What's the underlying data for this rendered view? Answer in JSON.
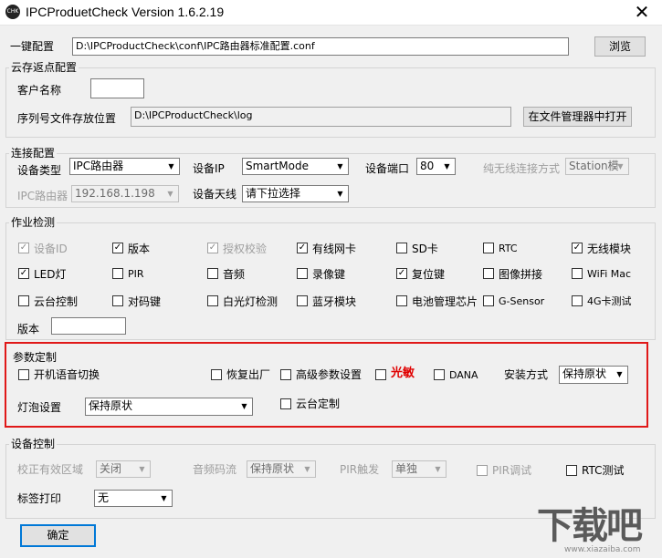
{
  "window": {
    "title": "IPCProduetCheck Version 1.6.2.19",
    "close": "✕",
    "icon_text": "CHK"
  },
  "top": {
    "label": "一键配置",
    "path": "D:\\IPCProductCheck\\conf\\IPC路由器标准配置.conf",
    "browse": "浏览"
  },
  "cloud": {
    "title": "云存返点配置",
    "customer_label": "客户名称",
    "customer_value": "",
    "serial_label": "序列号文件存放位置",
    "serial_path": "D:\\IPCProductCheck\\log",
    "open_btn": "在文件管理器中打开"
  },
  "conn": {
    "title": "连接配置",
    "device_type_label": "设备类型",
    "device_type": "IPC路由器",
    "device_ip_label": "设备IP",
    "device_ip": "SmartMode",
    "port_label": "设备端口",
    "port": "80",
    "wireless_label": "纯无线连接方式",
    "wireless_value": "Station模",
    "ipc_router_label": "IPC路由器",
    "ipc_router_ip": "192.168.1.198",
    "antenna_label": "设备天线",
    "antenna_value": "请下拉选择"
  },
  "job": {
    "title": "作业检测",
    "version_label": "版本",
    "version_value": "",
    "items": [
      {
        "label": "设备ID",
        "checked": true,
        "disabled": true
      },
      {
        "label": "版本",
        "checked": true,
        "disabled": false
      },
      {
        "label": "授权校验",
        "checked": true,
        "disabled": true
      },
      {
        "label": "有线网卡",
        "checked": true,
        "disabled": false
      },
      {
        "label": "SD卡",
        "checked": false,
        "disabled": false
      },
      {
        "label": "RTC",
        "checked": false,
        "disabled": false
      },
      {
        "label": "无线模块",
        "checked": true,
        "disabled": false
      },
      {
        "label": "LED灯",
        "checked": true,
        "disabled": false
      },
      {
        "label": "PIR",
        "checked": false,
        "disabled": false
      },
      {
        "label": "音频",
        "checked": false,
        "disabled": false
      },
      {
        "label": "录像键",
        "checked": false,
        "disabled": false
      },
      {
        "label": "复位键",
        "checked": true,
        "disabled": false
      },
      {
        "label": "图像拼接",
        "checked": false,
        "disabled": false
      },
      {
        "label": "WiFi Mac",
        "checked": false,
        "disabled": false
      },
      {
        "label": "云台控制",
        "checked": false,
        "disabled": false
      },
      {
        "label": "对码键",
        "checked": false,
        "disabled": false
      },
      {
        "label": "白光灯检测",
        "checked": false,
        "disabled": false
      },
      {
        "label": "蓝牙模块",
        "checked": false,
        "disabled": false
      },
      {
        "label": "电池管理芯片",
        "checked": false,
        "disabled": false
      },
      {
        "label": "G-Sensor",
        "checked": false,
        "disabled": false
      },
      {
        "label": "4G卡测试",
        "checked": false,
        "disabled": false
      }
    ]
  },
  "param": {
    "title": "参数定制",
    "boot_voice": "开机语音切换",
    "factory_reset": "恢复出厂",
    "advanced": "高级参数设置",
    "light_sens": "光敏",
    "dana": "DANA",
    "install_label": "安装方式",
    "install_value": "保持原状",
    "bulb_label": "灯泡设置",
    "bulb_value": "保持原状",
    "ptz_custom": "云台定制",
    "light_sens_color": "#e00000"
  },
  "devctl": {
    "title": "设备控制",
    "correct_label": "校正有效区域",
    "correct_value": "关闭",
    "audio_label": "音频码流",
    "audio_value": "保持原状",
    "pir_label": "PIR触发",
    "pir_value": "单独",
    "pir_debug": "PIR调试",
    "rtc_test": "RTC测试",
    "tag_label": "标签打印",
    "tag_value": "无"
  },
  "ok_button": "确定",
  "watermark": {
    "main": "下载吧",
    "sub": "www.xiazaiba.com"
  }
}
